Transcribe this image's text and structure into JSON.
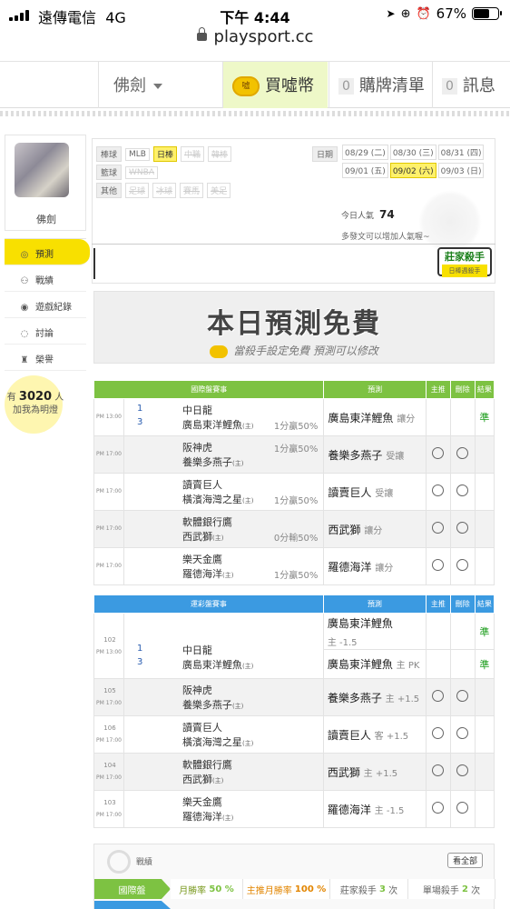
{
  "status_bar": {
    "carrier": "遠傳電信",
    "network": "4G",
    "time": "下午 4:44",
    "battery": "67%",
    "battery_level": 0.67
  },
  "url": "playsport.cc",
  "nav": {
    "user": "佛劍",
    "buy": "買噓幣",
    "list_count": "0",
    "list": "購牌清單",
    "msg_count": "0",
    "msg": "訊息"
  },
  "sidebar": {
    "username": "佛劍",
    "menu": [
      {
        "label": "預測",
        "icon": "target-icon"
      },
      {
        "label": "戰績",
        "icon": "chart-icon"
      },
      {
        "label": "遊戲紀錄",
        "icon": "record-icon"
      },
      {
        "label": "討論",
        "icon": "discuss-icon"
      },
      {
        "label": "榮譽",
        "icon": "honor-icon"
      }
    ],
    "fans_prefix": "有",
    "fans_count": "3020",
    "fans_suffix": "人",
    "fans_note": "加我為明燈"
  },
  "filter": {
    "row1_label": "棒球",
    "row1": [
      "MLB",
      "日棒",
      "中職",
      "韓棒"
    ],
    "row2_label": "籃球",
    "row2": [
      "WNBA"
    ],
    "row3_label": "其他",
    "row3": [
      "足球",
      "冰球",
      "賽馬",
      "美足"
    ],
    "date_label": "日期",
    "dates": [
      "08/29 (二)",
      "08/30 (三)",
      "08/31 (四)",
      "09/01 (五)",
      "09/02 (六)",
      "09/03 (日)"
    ],
    "selected_date": "09/02 (六)",
    "popularity_label": "今日人氣",
    "popularity": "74",
    "note": "多發文可以增加人氣喔~",
    "badge": "莊家殺手",
    "badge_sub": "日棒週殺手"
  },
  "banner": {
    "title": "本日預測免費",
    "subtitle": "當殺手設定免費 預測可以修改"
  },
  "table1": {
    "headers": [
      "國際盤賽事",
      "預測",
      "主推",
      "刪除",
      "結果"
    ],
    "rows": [
      {
        "time": "PM 13:00",
        "n1": "1",
        "n2": "3",
        "team1": "中日龍",
        "team2": "廣島東洋鯉魚",
        "team2_tag": "(主)",
        "odds": "1分贏50%",
        "odds_row": 2,
        "pick": "廣島東洋鯉魚",
        "pick_sub": "讓分",
        "result": "準"
      },
      {
        "time": "PM 17:00",
        "n1": "",
        "n2": "",
        "team1": "阪神虎",
        "team2": "養樂多燕子",
        "team2_tag": "(主)",
        "odds": "1分贏50%",
        "odds_row": 1,
        "pick": "養樂多燕子",
        "pick_sub": "受讓",
        "result": ""
      },
      {
        "time": "PM 17:00",
        "n1": "",
        "n2": "",
        "team1": "讀賣巨人",
        "team2": "橫濱海灣之星",
        "team2_tag": "(主)",
        "odds": "1分贏50%",
        "odds_row": 2,
        "pick": "讀賣巨人",
        "pick_sub": "受讓",
        "result": ""
      },
      {
        "time": "PM 17:00",
        "n1": "",
        "n2": "",
        "team1": "軟體銀行鷹",
        "team2": "西武獅",
        "team2_tag": "(主)",
        "odds": "0分輸50%",
        "odds_row": 2,
        "pick": "西武獅",
        "pick_sub": "讓分",
        "result": ""
      },
      {
        "time": "PM 17:00",
        "n1": "",
        "n2": "",
        "team1": "樂天金鷹",
        "team2": "羅德海洋",
        "team2_tag": "(主)",
        "odds": "1分贏50%",
        "odds_row": 2,
        "pick": "羅德海洋",
        "pick_sub": "讓分",
        "result": ""
      }
    ]
  },
  "table2": {
    "headers": [
      "運彩盤賽事",
      "預測",
      "主推",
      "刪除",
      "結果"
    ],
    "rows": [
      {
        "id": "102",
        "time": "PM 13:00",
        "n1": "1",
        "n2": "3",
        "team1": "中日龍",
        "team2": "廣島東洋鯉魚",
        "team2_tag": "(主)",
        "pick": "廣島東洋鯉魚",
        "pick_sub": "主 -1.5",
        "pick2": "廣島東洋鯉魚",
        "pick2_sub": "主 PK",
        "result": "準",
        "result2": "準"
      },
      {
        "id": "105",
        "time": "PM 17:00",
        "n1": "",
        "n2": "",
        "team1": "阪神虎",
        "team2": "養樂多燕子",
        "team2_tag": "(主)",
        "pick": "養樂多燕子",
        "pick_sub": "主 +1.5",
        "result": ""
      },
      {
        "id": "106",
        "time": "PM 17:00",
        "n1": "",
        "n2": "",
        "team1": "讀賣巨人",
        "team2": "橫濱海灣之星",
        "team2_tag": "(主)",
        "pick": "讀賣巨人",
        "pick_sub": "客 +1.5",
        "result": ""
      },
      {
        "id": "104",
        "time": "PM 17:00",
        "n1": "",
        "n2": "",
        "team1": "軟體銀行鷹",
        "team2": "西武獅",
        "team2_tag": "(主)",
        "pick": "西武獅",
        "pick_sub": "主 +1.5",
        "result": ""
      },
      {
        "id": "103",
        "time": "PM 17:00",
        "n1": "",
        "n2": "",
        "team1": "樂天金鷹",
        "team2": "羅德海洋",
        "team2_tag": "(主)",
        "pick": "羅德海洋",
        "pick_sub": "主 -1.5",
        "result": ""
      }
    ]
  },
  "stats": {
    "title": "戰績",
    "more": "看全部",
    "row_label": "國際盤",
    "monthly_label": "月勝率",
    "monthly": "50 %",
    "main_label": "主推月勝率",
    "main": "100 %",
    "killer_label": "莊家殺手",
    "killer": "3",
    "killer_unit": "次",
    "single_label": "單場殺手",
    "single": "2",
    "single_unit": "次"
  }
}
